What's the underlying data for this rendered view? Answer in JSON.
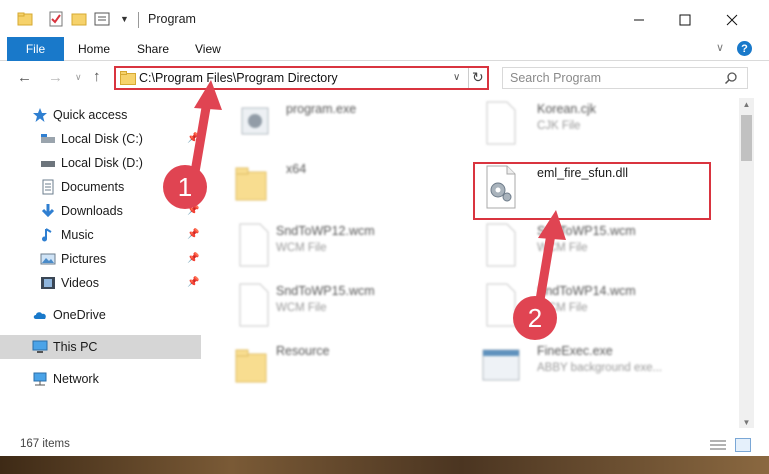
{
  "window": {
    "title": "Program",
    "quick_access_icons": [
      "folder-icon",
      "properties-icon",
      "new-folder-icon",
      "view-icon",
      "chevron-down-icon"
    ],
    "controls": [
      "minimize-icon",
      "maximize-icon",
      "close-icon"
    ]
  },
  "ribbon": {
    "tabs": [
      {
        "label": "File"
      },
      {
        "label": "Home"
      },
      {
        "label": "Share"
      },
      {
        "label": "View"
      }
    ],
    "help": "?"
  },
  "address": {
    "path": "C:\\Program Files\\Program Directory"
  },
  "search": {
    "placeholder": "Search Program"
  },
  "sidebar": {
    "items": [
      {
        "label": "Quick access",
        "icon": "star-icon"
      },
      {
        "label": "Local Disk (C:)",
        "icon": "drive-icon"
      },
      {
        "label": "Local Disk (D:)",
        "icon": "drive-icon"
      },
      {
        "label": "Documents",
        "icon": "documents-icon"
      },
      {
        "label": "Downloads",
        "icon": "download-icon"
      },
      {
        "label": "Music",
        "icon": "music-icon"
      },
      {
        "label": "Pictures",
        "icon": "pictures-icon"
      },
      {
        "label": "Videos",
        "icon": "videos-icon"
      },
      {
        "label": "OneDrive",
        "icon": "cloud-icon"
      },
      {
        "label": "This PC",
        "icon": "computer-icon"
      },
      {
        "label": "Network",
        "icon": "network-icon"
      }
    ]
  },
  "files": [
    {
      "name": "program.exe",
      "type": "",
      "icon": "program-icon"
    },
    {
      "name": "Korean.cjk",
      "type": "CJK File",
      "icon": "file-icon"
    },
    {
      "name": "x64",
      "type": "",
      "icon": "folder-icon"
    },
    {
      "name": "eml_fire_sfun.dll",
      "type": "",
      "icon": "dll-gear-icon"
    },
    {
      "name": "SndToWP12.wcm",
      "type": "WCM File",
      "icon": "file-icon"
    },
    {
      "name": "SndToWP15.wcm",
      "type": "WCM File",
      "icon": "file-icon"
    },
    {
      "name": "SndToWP15.wcm",
      "type": "WCM File",
      "icon": "file-icon"
    },
    {
      "name": "SndToWP14.wcm",
      "type": "WCM File",
      "icon": "file-icon"
    },
    {
      "name": "Resource",
      "type": "",
      "icon": "folder-icon"
    },
    {
      "name": "FineExec.exe",
      "type": "ABBY background exe...",
      "icon": "app-icon"
    }
  ],
  "status": {
    "count": "167 items"
  },
  "annotations": [
    {
      "label": "1"
    },
    {
      "label": "2"
    }
  ],
  "colors": {
    "accent": "#1979ca",
    "highlight": "#d9343f",
    "folder": "#f6d26b",
    "selected": "#d6d6d6"
  }
}
